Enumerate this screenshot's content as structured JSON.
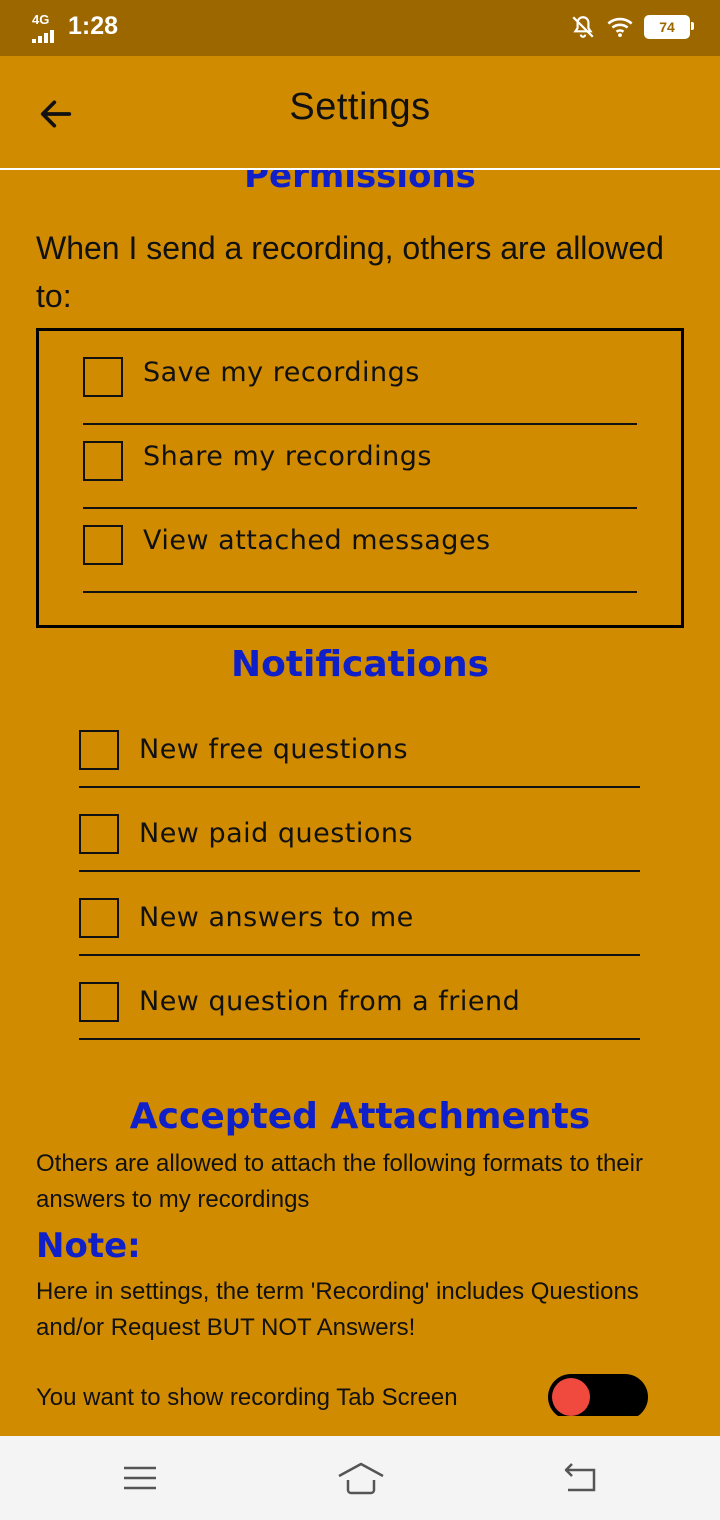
{
  "status_bar": {
    "network": "4G",
    "time": "1:28",
    "battery": "74",
    "icons": [
      "signal-icon",
      "bell-off-icon",
      "wifi-icon",
      "battery-icon"
    ]
  },
  "app_bar": {
    "title": "Settings",
    "back_icon": "back-arrow-icon"
  },
  "permissions": {
    "title": "Permissions",
    "description": "When I send a recording, others are allowed to:",
    "options": [
      {
        "label": "Save my recordings",
        "checked": false
      },
      {
        "label": "Share my recordings",
        "checked": false
      },
      {
        "label": "View attached messages",
        "checked": false
      }
    ]
  },
  "notifications": {
    "title": "Notifications",
    "options": [
      {
        "label": "New free questions",
        "checked": false
      },
      {
        "label": "New paid questions",
        "checked": false
      },
      {
        "label": "New answers to me",
        "checked": false
      },
      {
        "label": "New question from a friend",
        "checked": false
      }
    ]
  },
  "attachments": {
    "title": "Accepted Attachments",
    "description": "Others are allowed to attach the following formats to their answers to my recordings",
    "note_title": "Note:",
    "note_text": "Here in settings, the term 'Recording' includes Questions and/or Request BUT NOT Answers!"
  },
  "recording_tab": {
    "label": "You want to show recording Tab Screen",
    "enabled": false
  },
  "nav_bar": {
    "icons": [
      "menu-icon",
      "home-icon",
      "back-icon"
    ]
  },
  "colors": {
    "background": "#d18b00",
    "status_bar": "#9d6700",
    "section_title": "#1020c8",
    "toggle_knob": "#f04a3f"
  }
}
